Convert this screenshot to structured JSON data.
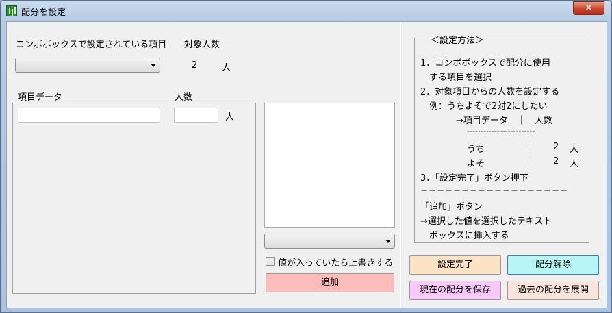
{
  "window": {
    "title": "配分を設定",
    "close_glyph": "✕"
  },
  "left": {
    "combo_label": "コンボボックスで設定されている項目",
    "target_count_label": "対象人数",
    "target_count_value": "2",
    "target_count_unit": "人",
    "item_data_header": "項目データ",
    "count_header": "人数",
    "row_unit": "人"
  },
  "middle": {
    "overwrite_label": "値が入っていたら上書きする",
    "add_button": "追加"
  },
  "help": {
    "title": "＜設定方法＞",
    "lines": [
      "1．コンボボックスで配分に使用",
      "　する項目を選択",
      "2．対象項目からの人数を設定する",
      "　例：うちよそで2対2にしたい",
      "→項目データ　｜　人数",
      "-------------------------",
      "うち",
      "よそ",
      "3．「設定完了」ボタン押下",
      "－－－－－－－－－－－－－－－－－－",
      "「追加」ボタン",
      "→選択した値を選択したテキスト",
      "　ボックスに挿入する"
    ],
    "sep": "｜",
    "val": "2",
    "unit": "人"
  },
  "buttons": {
    "complete": "設定完了",
    "release": "配分解除",
    "save": "現在の配分を保存",
    "expand": "過去の配分を展開"
  },
  "colors": {
    "complete_bg": "#fde3c6",
    "release_bg": "#b8f5f5",
    "save_bg": "#f8c8f8",
    "expand_bg": "#fbe4dc",
    "add_bg": "#fdbcbc"
  }
}
